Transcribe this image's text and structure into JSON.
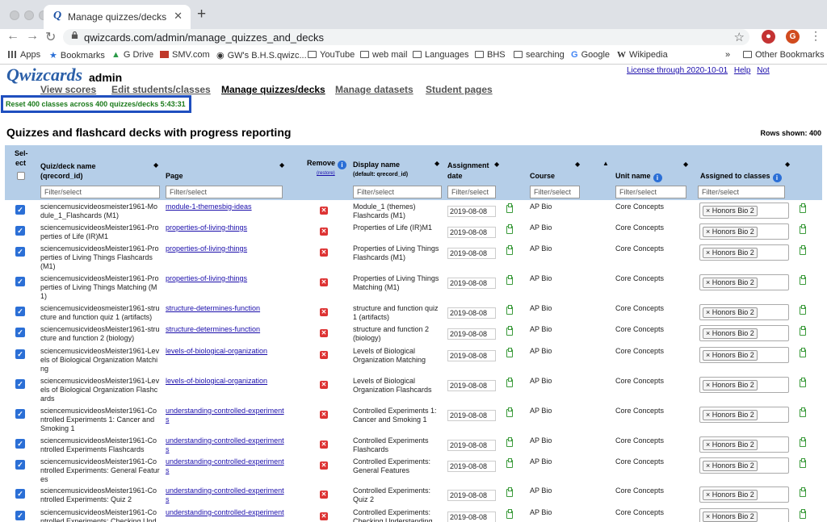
{
  "browser": {
    "tab_title": "Manage quizzes/decks",
    "tab_favicon": "Q",
    "url": "qwizcards.com/admin/manage_quizzes_and_decks",
    "profile_initial": "G",
    "bookmarks": [
      {
        "label": "Apps",
        "icon": "apps-grid-icon"
      },
      {
        "label": "Bookmarks",
        "icon": "star-icon"
      },
      {
        "label": "G Drive",
        "icon": "drive-icon"
      },
      {
        "label": "SMV.com",
        "icon": "smv-icon"
      },
      {
        "label": "GW's B.H.S.qwizc...",
        "icon": "site-icon"
      },
      {
        "label": "YouTube",
        "icon": "folder-icon"
      },
      {
        "label": "web mail",
        "icon": "folder-icon"
      },
      {
        "label": "Languages",
        "icon": "folder-icon"
      },
      {
        "label": "BHS",
        "icon": "folder-icon"
      },
      {
        "label": "searching",
        "icon": "folder-icon"
      },
      {
        "label": "Google",
        "icon": "google-icon"
      },
      {
        "label": "Wikipedia",
        "icon": "wikipedia-icon"
      }
    ],
    "more_bookmarks": "»",
    "other_bookmarks": "Other Bookmarks"
  },
  "site": {
    "logo": "Qwizcards",
    "role": "admin",
    "top_links": [
      "License through 2020-10-01",
      "Help",
      "Not"
    ],
    "nav": [
      {
        "label": "View scores",
        "active": false
      },
      {
        "label": "Edit students/classes",
        "active": false
      },
      {
        "label": "Manage quizzes/decks",
        "active": true
      },
      {
        "label": "Manage datasets",
        "active": false
      },
      {
        "label": "Student pages",
        "active": false
      }
    ],
    "reset_message": "Reset 400 classes across 400 quizzes/decks 5:43:31",
    "heading": "Quizzes and flashcard decks with progress reporting",
    "rows_shown": "Rows shown: 400"
  },
  "table": {
    "headers": {
      "select_1": "Sel-",
      "select_2": "ect",
      "quiz_1": "Quiz/deck name",
      "quiz_2": "(qrecord_id)",
      "page": "Page",
      "remove": "Remove",
      "restore": "(restore)",
      "display_1": "Display name",
      "display_2": "(default: qrecord_id)",
      "assign_1": "Assignment",
      "assign_2": "date",
      "course": "Course",
      "unit": "Unit name",
      "classes": "Assigned to classes"
    },
    "filter_placeholder": "Filter/select",
    "rows": [
      {
        "quiz": [
          "sciencemusicvideosmeister1961-Mo",
          "dule_1_Flashcards (M1)"
        ],
        "page": [
          "module-1-themesbig-ideas"
        ],
        "display": [
          "Module_1 (themes)",
          "Flashcards (M1)"
        ],
        "date": "2019-08-08",
        "course": "AP Bio",
        "unit": "Core Concepts",
        "class": "Honors Bio 2"
      },
      {
        "quiz": [
          "sciencemusicvideosMeister1961-Pro",
          "perties of Life (IR)M1"
        ],
        "page": [
          "properties-of-living-things"
        ],
        "display": [
          "Properties of Life (IR)M1"
        ],
        "date": "2019-08-08",
        "course": "AP Bio",
        "unit": "Core Concepts",
        "class": "Honors Bio 2"
      },
      {
        "quiz": [
          "sciencemusicvideosMeister1961-Pro",
          "perties of Living Things Flashcards",
          "(M1)"
        ],
        "page": [
          "properties-of-living-things"
        ],
        "display": [
          "Properties of Living Things",
          "Flashcards (M1)"
        ],
        "date": "2019-08-08",
        "course": "AP Bio",
        "unit": "Core Concepts",
        "class": "Honors Bio 2"
      },
      {
        "quiz": [
          "sciencemusicvideosMeister1961-Pro",
          "perties of Living Things Matching (M",
          "1)"
        ],
        "page": [
          "properties-of-living-things"
        ],
        "display": [
          "Properties of Living Things",
          "Matching (M1)"
        ],
        "date": "2019-08-08",
        "course": "AP Bio",
        "unit": "Core Concepts",
        "class": "Honors Bio 2"
      },
      {
        "quiz": [
          "sciencemusicvideosmeister1961-stru",
          "cture and function quiz 1 (artifacts)"
        ],
        "page": [
          "structure-determines-function"
        ],
        "display": [
          "structure and function quiz",
          "1 (artifacts)"
        ],
        "date": "2019-08-08",
        "course": "AP Bio",
        "unit": "Core Concepts",
        "class": "Honors Bio 2"
      },
      {
        "quiz": [
          "sciencemusicvideosMeister1961-stru",
          "cture and function 2 (biology)"
        ],
        "page": [
          "structure-determines-function"
        ],
        "display": [
          "structure and function 2",
          "(biology)"
        ],
        "date": "2019-08-08",
        "course": "AP Bio",
        "unit": "Core Concepts",
        "class": "Honors Bio 2"
      },
      {
        "quiz": [
          "sciencemusicvideosMeister1961-Lev",
          "els of Biological Organization Matchi",
          "ng"
        ],
        "page": [
          "levels-of-biological-organization"
        ],
        "display": [
          "Levels of Biological",
          "Organization Matching"
        ],
        "date": "2019-08-08",
        "course": "AP Bio",
        "unit": "Core Concepts",
        "class": "Honors Bio 2"
      },
      {
        "quiz": [
          "sciencemusicvideosMeister1961-Lev",
          "els of Biological Organization Flashc",
          "ards"
        ],
        "page": [
          "levels-of-biological-organization"
        ],
        "display": [
          "Levels of Biological",
          "Organization Flashcards"
        ],
        "date": "2019-08-08",
        "course": "AP Bio",
        "unit": "Core Concepts",
        "class": "Honors Bio 2"
      },
      {
        "quiz": [
          "sciencemusicvideosMeister1961-Co",
          "ntrolled Experiments 1: Cancer and",
          "Smoking 1"
        ],
        "page": [
          "understanding-controlled-experiment",
          "s"
        ],
        "display": [
          "Controlled Experiments 1:",
          "Cancer and Smoking 1"
        ],
        "date": "2019-08-08",
        "course": "AP Bio",
        "unit": "Core Concepts",
        "class": "Honors Bio 2"
      },
      {
        "quiz": [
          "sciencemusicvideosMeister1961-Co",
          "ntrolled Experiments Flashcards"
        ],
        "page": [
          "understanding-controlled-experiment",
          "s"
        ],
        "display": [
          "Controlled Experiments",
          "Flashcards"
        ],
        "date": "2019-08-08",
        "course": "AP Bio",
        "unit": "Core Concepts",
        "class": "Honors Bio 2"
      },
      {
        "quiz": [
          "sciencemusicvideosMeister1961-Co",
          "ntrolled Experiments: General Featur",
          "es"
        ],
        "page": [
          "understanding-controlled-experiment",
          "s"
        ],
        "display": [
          "Controlled Experiments:",
          "General Features"
        ],
        "date": "2019-08-08",
        "course": "AP Bio",
        "unit": "Core Concepts",
        "class": "Honors Bio 2"
      },
      {
        "quiz": [
          "sciencemusicvideosMeister1961-Co",
          "ntrolled Experiments: Quiz 2"
        ],
        "page": [
          "understanding-controlled-experiment",
          "s"
        ],
        "display": [
          "Controlled Experiments:",
          "Quiz 2"
        ],
        "date": "2019-08-08",
        "course": "AP Bio",
        "unit": "Core Concepts",
        "class": "Honors Bio 2"
      },
      {
        "quiz": [
          "sciencemusicvideosMeister1961-Co",
          "ntrolled Experiments: Checking Und"
        ],
        "page": [
          "understanding-controlled-experiment"
        ],
        "display": [
          "Controlled Experiments:",
          "Checking Understanding"
        ],
        "date": "2019-08-08",
        "course": "AP Bio",
        "unit": "Core Concepts",
        "class": "Honors Bio 2"
      }
    ]
  }
}
